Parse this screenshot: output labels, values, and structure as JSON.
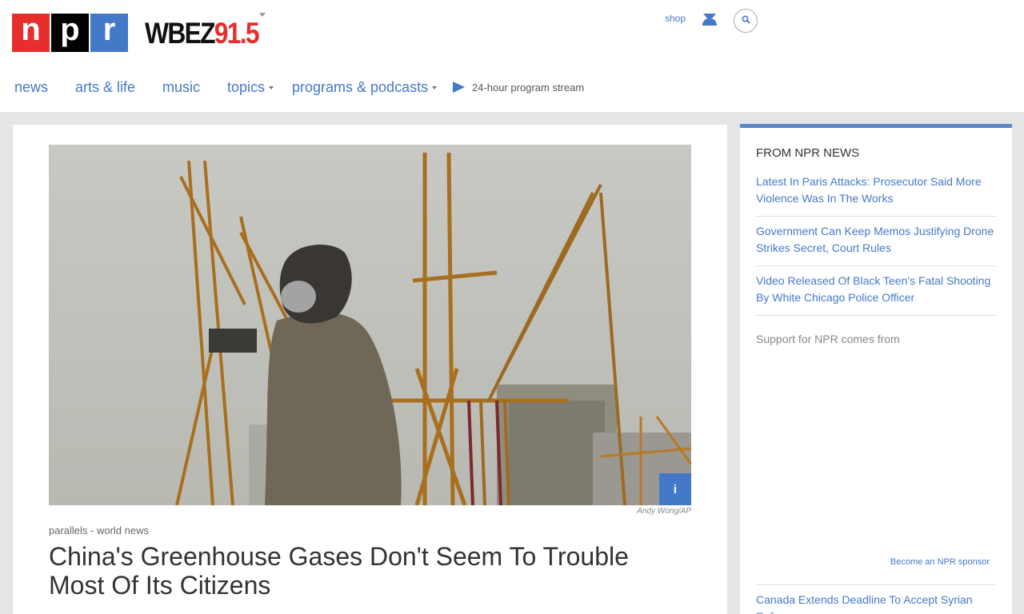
{
  "header": {
    "logo": {
      "n": "n",
      "p": "p",
      "r": "r"
    },
    "station": {
      "part1": "WBEZ",
      "part2": "91.5"
    },
    "utility": {
      "shop": "shop",
      "user_icon": "user-icon",
      "search_icon": "search-icon"
    }
  },
  "nav": {
    "items": [
      {
        "label": "news"
      },
      {
        "label": "arts & life"
      },
      {
        "label": "music"
      },
      {
        "label": "topics"
      },
      {
        "label": "programs & podcasts"
      }
    ],
    "stream_label": "24-hour program stream"
  },
  "article": {
    "photo_credit": "Andy Wong/AP",
    "info_label": "i",
    "slug": "parallels - world news",
    "headline": "China's Greenhouse Gases Don't Seem To Trouble Most Of Its Citizens"
  },
  "sidebar": {
    "title": "FROM NPR NEWS",
    "items": [
      {
        "text": "Latest In Paris Attacks: Prosecutor Said More Violence Was In The Works"
      },
      {
        "text": "Government Can Keep Memos Justifying Drone Strikes Secret, Court Rules"
      },
      {
        "text": "Video Released Of Black Teen's Fatal Shooting By White Chicago Police Officer"
      }
    ],
    "support_text": "Support for NPR comes from",
    "sponsor_link": "Become an NPR sponsor",
    "next_item": "Canada Extends Deadline To Accept Syrian Refugees"
  },
  "colors": {
    "npr_red": "#e62e2c",
    "npr_black": "#000000",
    "npr_blue": "#4479c8",
    "link_blue": "#4479c8",
    "sidebar_border": "#5b86c9",
    "page_background": "#e5e5e5"
  }
}
